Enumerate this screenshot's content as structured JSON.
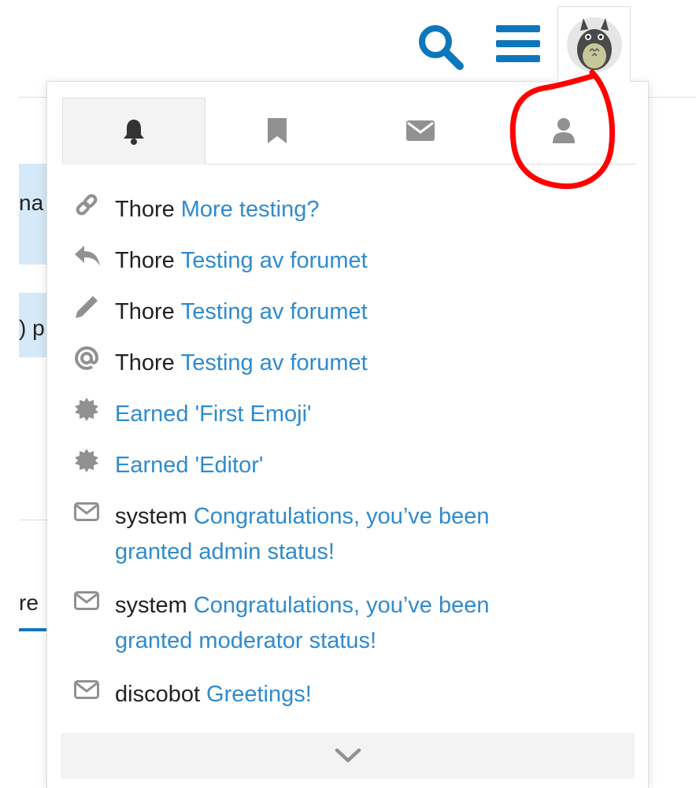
{
  "header": {
    "search_icon": "search-icon",
    "menu_icon": "hamburger-menu-icon",
    "avatar_icon": "user-avatar"
  },
  "background": {
    "frag1": "na",
    "frag2": ") p",
    "frag3": "re"
  },
  "tabs": [
    {
      "icon": "bell-icon",
      "active": true
    },
    {
      "icon": "bookmark-icon",
      "active": false
    },
    {
      "icon": "envelope-icon",
      "active": false
    },
    {
      "icon": "user-icon",
      "active": false
    }
  ],
  "notifications": [
    {
      "icon": "link-icon",
      "user": "Thore",
      "text": "More testing?"
    },
    {
      "icon": "reply-icon",
      "user": "Thore",
      "text": "Testing av forumet"
    },
    {
      "icon": "pencil-icon",
      "user": "Thore",
      "text": "Testing av forumet"
    },
    {
      "icon": "at-icon",
      "user": "Thore",
      "text": "Testing av forumet"
    },
    {
      "icon": "badge-icon",
      "user": "",
      "text": "Earned 'First Emoji'"
    },
    {
      "icon": "badge-icon",
      "user": "",
      "text": "Earned 'Editor'"
    },
    {
      "icon": "envelope-outline-icon",
      "user": "system",
      "text": "Congratulations, you’ve been",
      "text2": "granted admin status!"
    },
    {
      "icon": "envelope-outline-icon",
      "user": "system",
      "text": "Congratulations, you’ve been",
      "text2": "granted moderator status!"
    },
    {
      "icon": "envelope-outline-icon",
      "user": "discobot",
      "text": "Greetings!"
    }
  ],
  "expand": {
    "icon": "chevron-down-icon"
  },
  "colors": {
    "accent": "#2f8bcd",
    "icon": "#919191",
    "annotation": "#ff0000"
  }
}
